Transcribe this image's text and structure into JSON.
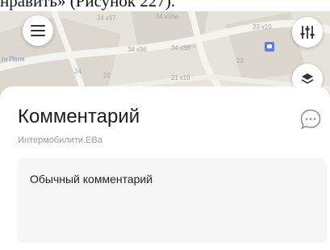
{
  "document": {
    "caption_fragment": "нравить» (Рисунок 227)."
  },
  "map": {
    "building_labels": [
      "34 к37",
      "34 к16а",
      "23 к10",
      "34 к36",
      "34 к38",
      "24",
      "22",
      "23",
      "21 к10"
    ],
    "street_label": "го Поля"
  },
  "buttons": {
    "menu_icon": "hamburger-menu-icon",
    "filters_icon": "sliders-icon",
    "layers_icon": "layers-icon",
    "chat_icon": "chat-bubble-icon"
  },
  "sheet": {
    "title": "Комментарий",
    "subtitle": "Интермобилити.ЕВа",
    "comment_text": "Обычный комментарий"
  },
  "colors": {
    "map_background": "#e6e3dc",
    "sheet_background": "#ffffff",
    "comment_background": "#f6f6f6",
    "street_label": "#6b8fd6"
  }
}
